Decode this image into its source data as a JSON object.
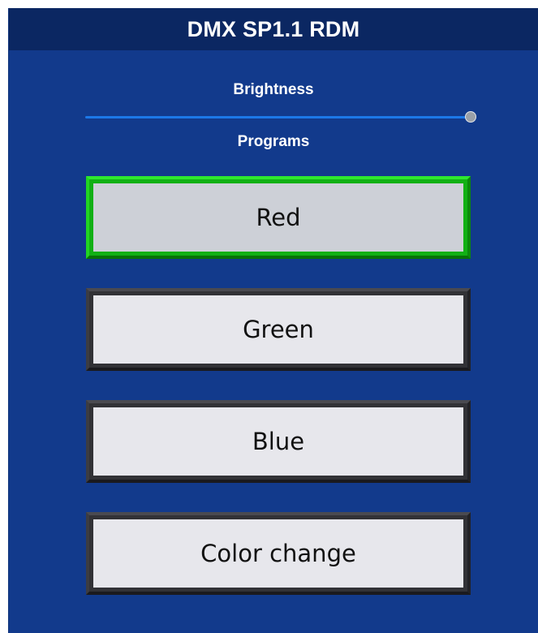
{
  "header": {
    "title": "DMX SP1.1 RDM"
  },
  "brightness": {
    "label": "Brightness",
    "value_fraction": 1.0
  },
  "programs": {
    "label": "Programs",
    "active_index": 0,
    "items": [
      {
        "label": "Red"
      },
      {
        "label": "Green"
      },
      {
        "label": "Blue"
      },
      {
        "label": "Color change"
      }
    ]
  },
  "colors": {
    "panel_background": "#123a8c",
    "title_background": "#0b2762",
    "active_border": "#11b014",
    "inactive_border": "#323236",
    "slider_track": "#1c78e8"
  }
}
